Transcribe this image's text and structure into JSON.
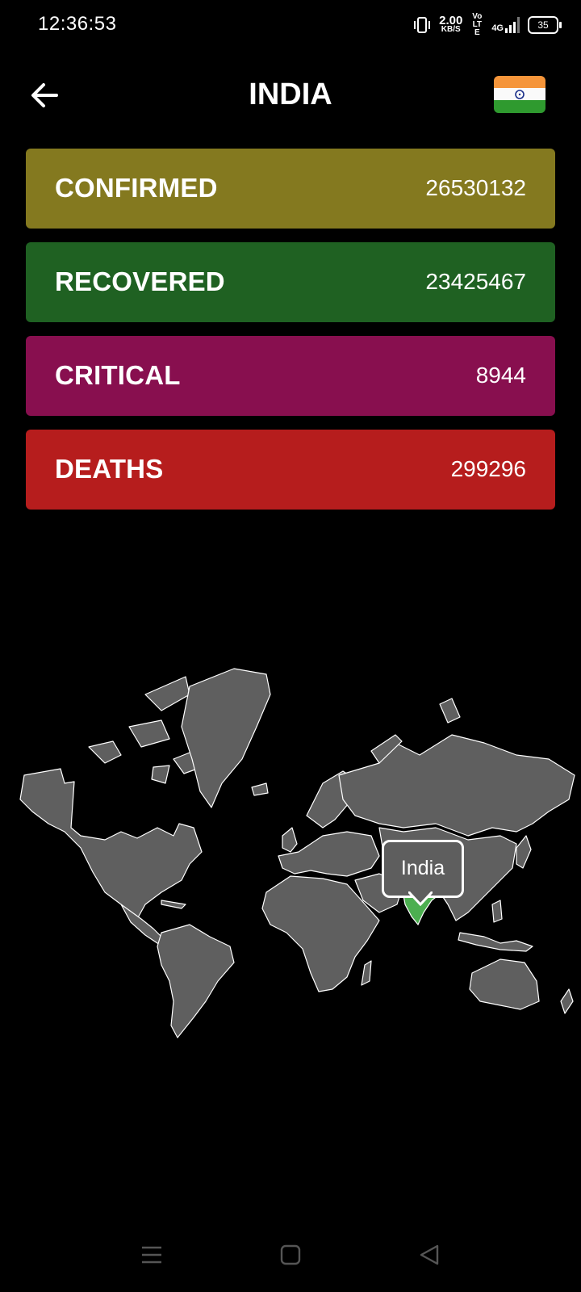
{
  "status_bar": {
    "time": "12:36:53",
    "speed_value": "2.00",
    "speed_unit": "KB/S",
    "volte": "Vo LTE",
    "network": "4G",
    "battery": "35"
  },
  "header": {
    "title": "INDIA",
    "back_icon": "arrow-left-icon",
    "flag_icon": "india-flag-icon"
  },
  "stats": [
    {
      "label": "CONFIRMED",
      "value": "26530132",
      "color": "#84791f"
    },
    {
      "label": "RECOVERED",
      "value": "23425467",
      "color": "#1f6122"
    },
    {
      "label": "CRITICAL",
      "value": "8944",
      "color": "#880f4f"
    },
    {
      "label": "DEATHS",
      "value": "299296",
      "color": "#b61d1d"
    }
  ],
  "map": {
    "highlight_country": "India",
    "tooltip_label": "India",
    "land_color": "#5f5f5f",
    "highlight_color": "#4caf50"
  },
  "nav_bar": {
    "menu_icon": "menu-icon",
    "home_icon": "square-home-icon",
    "back_icon": "triangle-back-icon"
  }
}
